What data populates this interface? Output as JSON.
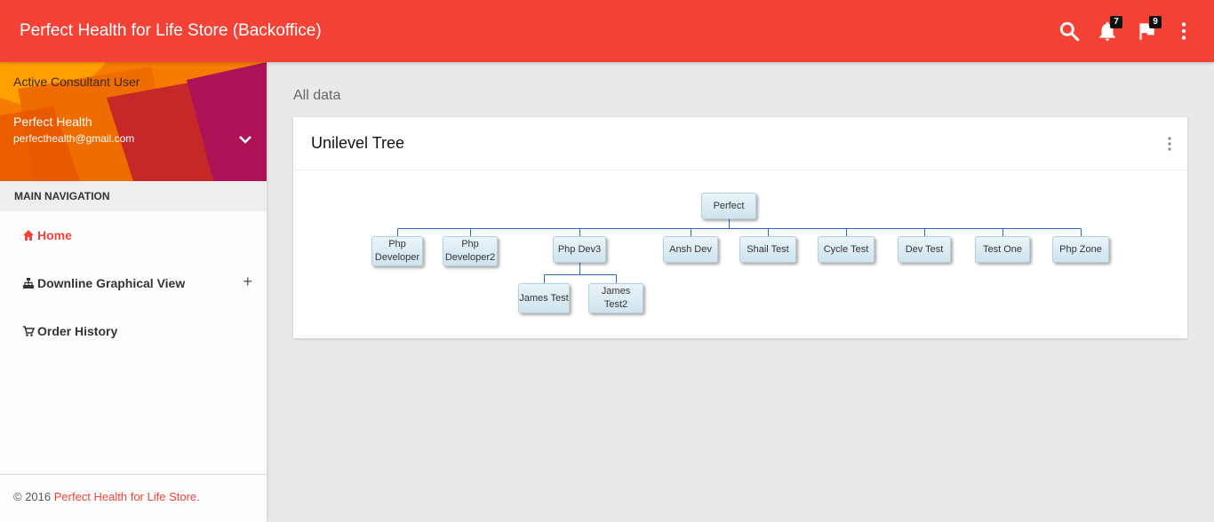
{
  "app": {
    "title": "Perfect Health for Life Store (Backoffice)"
  },
  "topbar": {
    "notifications_count": "7",
    "tasks_count": "9",
    "icons": [
      "search-icon",
      "bell-icon",
      "flag-icon",
      "more-vert-icon"
    ]
  },
  "colors": {
    "primary": "#f44336",
    "node_bg": "#d6e8f2",
    "tree_line": "#2a6db5"
  },
  "sidebar": {
    "user": {
      "status": "Active Consultant User",
      "name": "Perfect Health",
      "email": "perfecthealth@gmail.com"
    },
    "nav_header": "MAIN NAVIGATION",
    "items": [
      {
        "label": "Home",
        "icon": "home-icon"
      },
      {
        "label": "Downline Graphical View",
        "icon": "sitemap-icon"
      },
      {
        "label": "Order History",
        "icon": "cart-icon"
      }
    ],
    "footer": {
      "copyright": "© 2016 ",
      "brand": "Perfect Health for Life Store",
      "suffix": "."
    }
  },
  "main": {
    "block_header": "All data",
    "card_title": "Unilevel Tree",
    "tree": {
      "root": "Perfect",
      "children": [
        {
          "name": "Php Developer",
          "children": []
        },
        {
          "name": "Php Developer2",
          "children": []
        },
        {
          "name": "Php Dev3",
          "children": [
            "James Test",
            "James Test2"
          ]
        },
        {
          "name": "Ansh Dev",
          "children": []
        },
        {
          "name": "Shail Test",
          "children": []
        },
        {
          "name": "Cycle Test",
          "children": []
        },
        {
          "name": "Dev Test",
          "children": []
        },
        {
          "name": "Test One",
          "children": []
        },
        {
          "name": "Php Zone",
          "children": []
        }
      ]
    }
  }
}
